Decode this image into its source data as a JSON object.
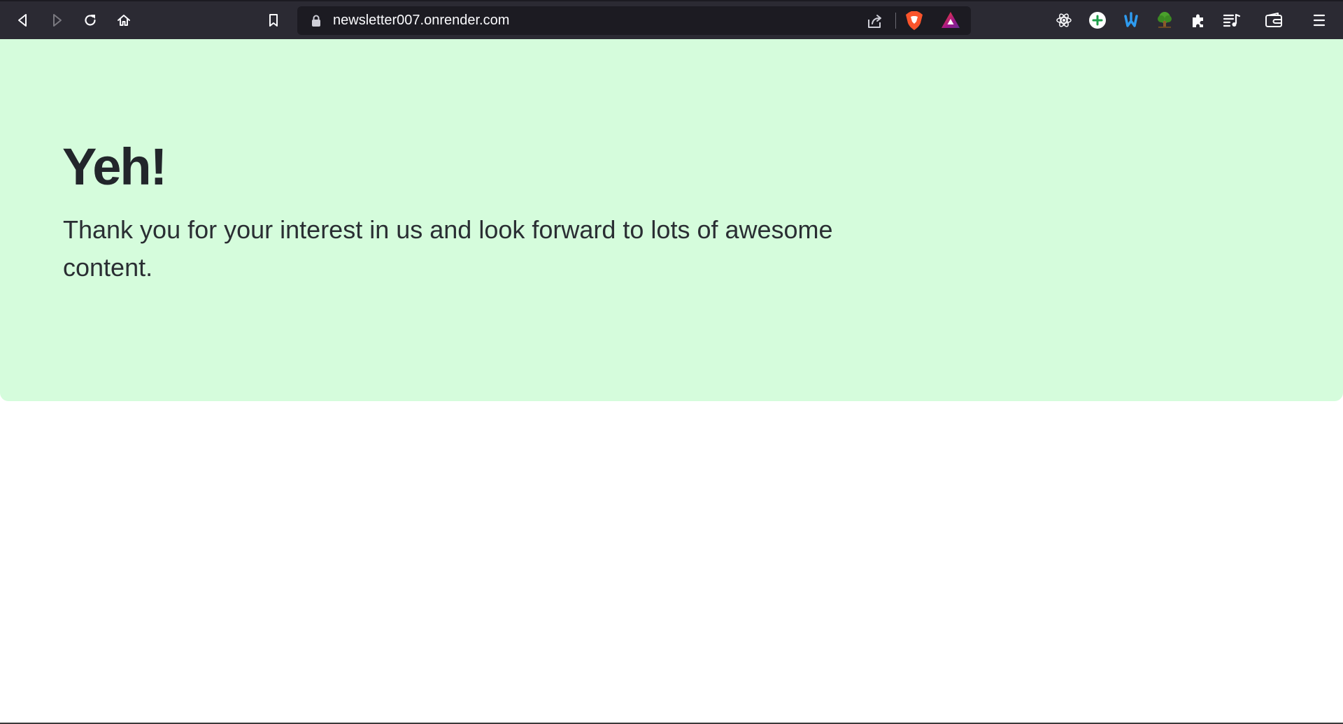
{
  "browser": {
    "url": "newsletter007.onrender.com",
    "nav_icons": [
      "back-icon",
      "forward-icon",
      "reload-icon",
      "home-icon",
      "bookmark-icon"
    ],
    "url_icons": [
      "lock-icon",
      "share-icon",
      "brave-shields-icon",
      "brave-rewards-icon"
    ],
    "extension_icons": [
      "react-devtools-icon",
      "add-icon",
      "extension-w-icon",
      "tree-extension-icon",
      "extensions-puzzle-icon",
      "playlist-icon",
      "wallet-icon",
      "menu-icon"
    ],
    "colors": {
      "toolbar_bg": "#2b2a33",
      "urlbar_bg": "#1c1b22",
      "brave_orange": "#fb542b"
    }
  },
  "page": {
    "title": "Yeh!",
    "message": "Thank you for your interest in us and look forward to lots of awesome content.",
    "colors": {
      "hero_bg": "#d5fcdc",
      "text": "#22262b"
    }
  }
}
